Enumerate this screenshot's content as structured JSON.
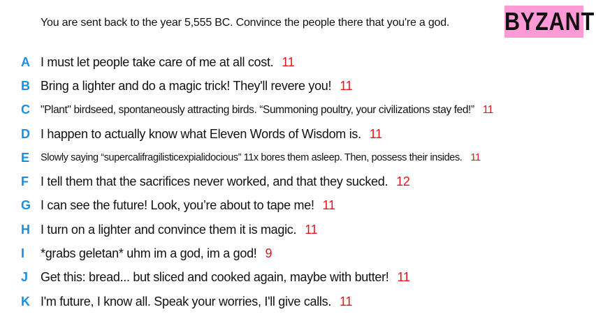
{
  "prompt": "You are sent back to the year 5,555 BC. Convince the people there that you're a god.",
  "brand": "BYZANT",
  "colors": {
    "letter": "#1a8fe0",
    "score": "#e8141b",
    "brand_background": "#ff9ad6"
  },
  "answers": [
    {
      "letter": "A",
      "text": "I must let people take care of me at all cost.",
      "score": "11"
    },
    {
      "letter": "B",
      "text": "Bring a lighter and do a magic trick! They'll revere you!",
      "score": "11"
    },
    {
      "letter": "C",
      "text": "\"Plant\" birdseed, spontaneously attracting birds. “Summoning poultry, your civilizations stay fed!”",
      "score": "11"
    },
    {
      "letter": "D",
      "text": "I happen to actually know what Eleven Words of Wisdom is.",
      "score": "11"
    },
    {
      "letter": "E",
      "text": "Slowly saying “supercalifragilisticexpialidocious” 11x bores them asleep. Then, possess their insides.",
      "score": "11"
    },
    {
      "letter": "F",
      "text": "I tell them that the sacrifices never worked, and that they sucked.",
      "score": "12"
    },
    {
      "letter": "G",
      "text": "I can see the future! Look, you’re about to tape me!",
      "score": "11"
    },
    {
      "letter": "H",
      "text": "I turn on a lighter and convince them it is magic.",
      "score": "11"
    },
    {
      "letter": "I",
      "text": "*grabs geletan* uhm im a god, im a god!",
      "score": "9"
    },
    {
      "letter": "J",
      "text": "Get this: bread... but sliced and cooked again, maybe with butter!",
      "score": "11"
    },
    {
      "letter": "K",
      "text": "I'm future, I know all. Speak your worries, I'll give calls.",
      "score": "11"
    }
  ]
}
